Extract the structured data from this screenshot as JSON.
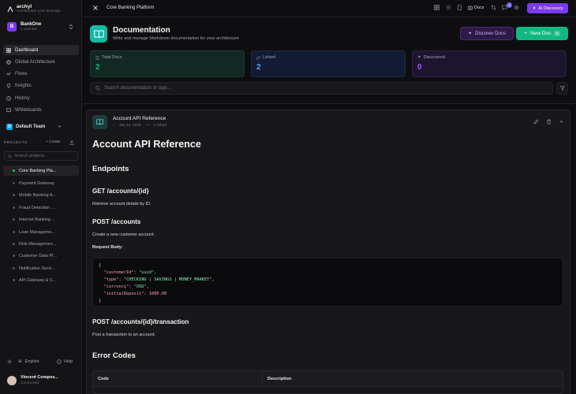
{
  "brand": {
    "name": "archyl",
    "tagline": "Architecture your leverage"
  },
  "workspace": {
    "initial": "B",
    "name": "BankOne",
    "members": "1 member"
  },
  "nav": [
    {
      "label": "Dashboard",
      "icon": "grid-icon"
    },
    {
      "label": "Global Architecture",
      "icon": "globe-icon"
    },
    {
      "label": "Flows",
      "icon": "flow-icon"
    },
    {
      "label": "Insights",
      "icon": "lightbulb-icon"
    },
    {
      "label": "History",
      "icon": "clock-icon"
    },
    {
      "label": "Whiteboards",
      "icon": "whiteboard-icon"
    }
  ],
  "team": {
    "initial": "D",
    "name": "Default Team"
  },
  "projects": {
    "heading": "PROJECTS",
    "create_label": "+ Create",
    "search_placeholder": "Search projects...",
    "items": [
      "Core Banking Pla...",
      "Payment Gateway",
      "Mobile Banking A...",
      "Fraud Detection ...",
      "Internet Banking ...",
      "Loan Manageme...",
      "Risk Managemen...",
      "Customer Data Pl...",
      "Notification Servi...",
      "API Gateway & S..."
    ]
  },
  "footer": {
    "language": "English",
    "help": "Help",
    "user_name": "Vincent Compos...",
    "user_status": "Connected"
  },
  "topbar": {
    "title": "Core Banking Platform",
    "docs_label": "Docs",
    "notification_count": "1",
    "ai_button": "AI Discovery"
  },
  "header": {
    "title": "Documentation",
    "subtitle": "Write and manage Markdown documentation for your architecture",
    "discover_button": "Discover Docs",
    "new_doc_button": "New Doc",
    "new_doc_kbd": "N"
  },
  "stats": {
    "total": {
      "label": "Total Docs",
      "value": "2"
    },
    "linked": {
      "label": "Linked",
      "value": "2"
    },
    "discovered": {
      "label": "Discovered",
      "value": "0"
    }
  },
  "search": {
    "placeholder": "Search documentation or tags..."
  },
  "doc": {
    "title": "Account API Reference",
    "date": "Jan 23, 2026",
    "linked": "1 linked",
    "h1": "Account API Reference",
    "endpoints_heading": "Endpoints",
    "get_heading": "GET /accounts/{id}",
    "get_desc": "Retrieve account details by ID.",
    "post_heading": "POST /accounts",
    "post_desc": "Create a new customer account.",
    "request_body_label": "Request Body:",
    "code": {
      "open": "{",
      "customerId_key": "\"customerId\"",
      "customerId_val": "\"uuid\"",
      "type_key": "\"type\"",
      "type_val": "\"CHECKING | SAVINGS | MONEY_MARKET\"",
      "currency_key": "\"currency\"",
      "currency_val": "\"USD\"",
      "deposit_key": "\"initialDeposit\"",
      "deposit_val": "1000.00",
      "close": "}"
    },
    "txn_heading": "POST /accounts/{id}/transaction",
    "txn_desc": "Post a transaction to an account.",
    "errors_heading": "Error Codes",
    "table_headers": [
      "Code",
      "Description"
    ]
  },
  "colors": {
    "accent_teal": "#14b8a6",
    "accent_green": "#10b981",
    "accent_purple": "#7c3aed",
    "accent_blue": "#60a5fa"
  }
}
